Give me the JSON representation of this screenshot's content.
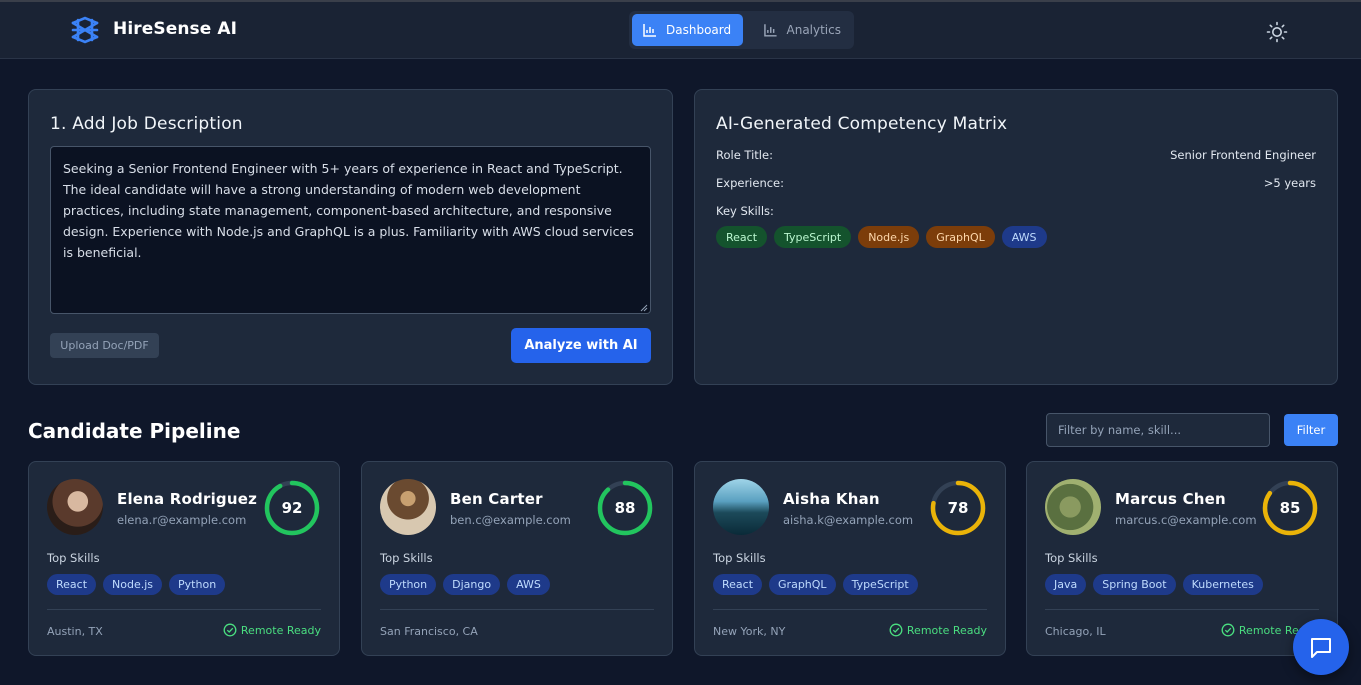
{
  "app": {
    "name": "HireSense AI"
  },
  "nav": {
    "tabs": [
      {
        "label": "Dashboard",
        "icon": "bar-chart-icon",
        "active": true
      },
      {
        "label": "Analytics",
        "icon": "bar-chart-icon",
        "active": false
      }
    ],
    "theme_icon": "sun-icon"
  },
  "job_description": {
    "title": "1. Add Job Description",
    "text": "Seeking a Senior Frontend Engineer with 5+ years of experience in React and TypeScript. The ideal candidate will have a strong understanding of modern web development practices, including state management, component-based architecture, and responsive design. Experience with Node.js and GraphQL is a plus. Familiarity with AWS cloud services is beneficial.",
    "upload_label": "Upload Doc/PDF",
    "analyze_label": "Analyze with AI"
  },
  "matrix": {
    "title": "AI-Generated Competency Matrix",
    "role_label": "Role Title:",
    "role_value": "Senior Frontend Engineer",
    "experience_label": "Experience:",
    "experience_value": ">5 years",
    "skills_label": "Key Skills:",
    "skills": [
      {
        "name": "React",
        "color": "green"
      },
      {
        "name": "TypeScript",
        "color": "green"
      },
      {
        "name": "Node.js",
        "color": "orange"
      },
      {
        "name": "GraphQL",
        "color": "orange"
      },
      {
        "name": "AWS",
        "color": "blue"
      }
    ]
  },
  "pipeline": {
    "title": "Candidate Pipeline",
    "filter_placeholder": "Filter by name, skill...",
    "filter_label": "Filter",
    "top_skills_label": "Top Skills",
    "remote_label": "Remote Ready",
    "candidates": [
      {
        "name": "Elena Rodriguez",
        "email": "elena.r@example.com",
        "score": 92,
        "score_color": "#22c55e",
        "skills": [
          "React",
          "Node.js",
          "Python"
        ],
        "location": "Austin, TX",
        "remote": true
      },
      {
        "name": "Ben Carter",
        "email": "ben.c@example.com",
        "score": 88,
        "score_color": "#22c55e",
        "skills": [
          "Python",
          "Django",
          "AWS"
        ],
        "location": "San Francisco, CA",
        "remote": false
      },
      {
        "name": "Aisha Khan",
        "email": "aisha.k@example.com",
        "score": 78,
        "score_color": "#eab308",
        "skills": [
          "React",
          "GraphQL",
          "TypeScript"
        ],
        "location": "New York, NY",
        "remote": true
      },
      {
        "name": "Marcus Chen",
        "email": "marcus.c@example.com",
        "score": 85,
        "score_color": "#eab308",
        "skills": [
          "Java",
          "Spring Boot",
          "Kubernetes"
        ],
        "location": "Chicago, IL",
        "remote": true
      }
    ]
  },
  "chat": {
    "icon": "chat-bubble-icon"
  }
}
